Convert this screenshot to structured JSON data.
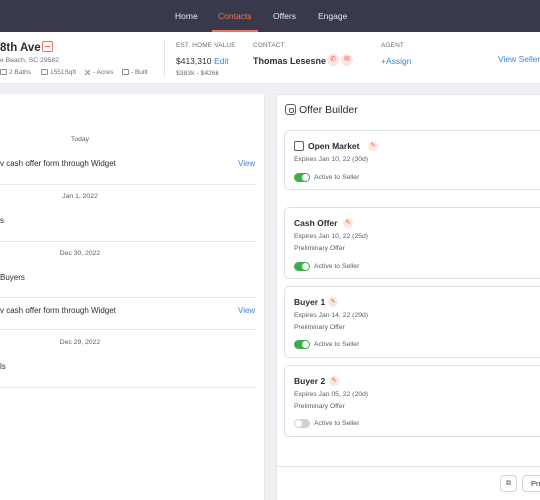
{
  "nav": {
    "tabs": [
      {
        "label": "Home"
      },
      {
        "label": "Contacts",
        "active": true
      },
      {
        "label": "Offers"
      },
      {
        "label": "Engage"
      }
    ],
    "accent": "#f0735a",
    "background": "#383a4b"
  },
  "contact_header": {
    "address_title": "8th Ave",
    "address_sub": "e Beach, SC 29582",
    "specs": {
      "baths": "2 Baths",
      "sqft": "1551Sqft",
      "acres": "- Acres",
      "built": "- Built"
    },
    "home_value_label": "EST. HOME VALUE",
    "home_value": "$413,310",
    "edit_label": "Edit",
    "home_value_range": "$383k - $426k",
    "contact_label": "CONTACT",
    "contact_name": "Thomas Lesesne",
    "agent_label": "AGENT",
    "assign_label": "+Assign",
    "view_seller_label": "View Seller"
  },
  "activity": {
    "groups": [
      {
        "date": "Today",
        "items": [
          {
            "text": "v cash offer form through Widget",
            "view": "View"
          }
        ]
      },
      {
        "date": "Jan 1, 2022",
        "items": [
          {
            "text": "s",
            "view": ""
          }
        ]
      },
      {
        "date": "Dec 30, 2022",
        "items": [
          {
            "text": "Buyers",
            "view": ""
          },
          {
            "text": "v cash offer form through Widget",
            "view": "View"
          }
        ]
      },
      {
        "date": "Dec 29, 2022",
        "items": [
          {
            "text": "ls",
            "view": ""
          }
        ]
      }
    ]
  },
  "offer_builder": {
    "title": "Offer Builder",
    "cards": [
      {
        "title": "Open Market",
        "expires": "Expires Jan 10, 22 (30d)",
        "prelim": "",
        "toggle_label": "Active to Seller",
        "active": true
      },
      {
        "title": "Cash Offer",
        "expires": "Expires Jan 10, 22 (25d)",
        "prelim": "Preliminary Offer",
        "toggle_label": "Active to Seller",
        "active": true
      },
      {
        "title": "Buyer 1",
        "expires": "Expires Jan 14, 22 (29d)",
        "prelim": "Preliminary Offer",
        "toggle_label": "Active to Seller",
        "active": true
      },
      {
        "title": "Buyer 2",
        "expires": "Expires Jan 05, 22 (20d)",
        "prelim": "Preliminary Offer",
        "toggle_label": "Active to Seller",
        "active": false
      }
    ],
    "footer_button_label": "Pre",
    "toggle_on_color": "#3cae4b"
  }
}
